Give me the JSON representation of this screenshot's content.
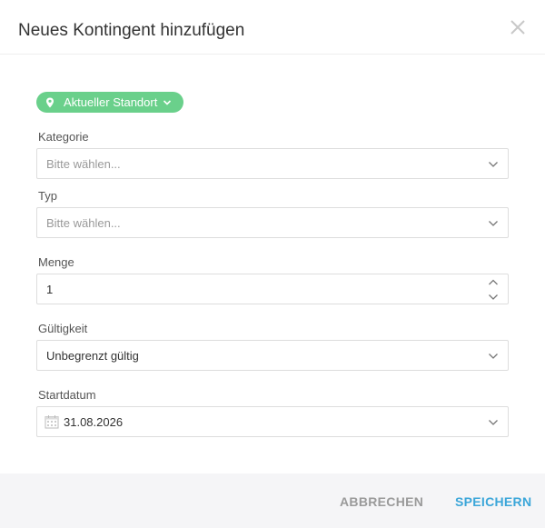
{
  "dialog": {
    "title": "Neues Kontingent hinzufügen",
    "close_icon": "close-icon"
  },
  "location": {
    "label": "Aktueller Standort",
    "icon": "map-pin-icon",
    "color": "#6ad08b"
  },
  "fields": {
    "kategorie": {
      "label": "Kategorie",
      "placeholder": "Bitte wählen..."
    },
    "typ": {
      "label": "Typ",
      "placeholder": "Bitte wählen..."
    },
    "menge": {
      "label": "Menge",
      "value": "1"
    },
    "gueltigkeit": {
      "label": "Gültigkeit",
      "value": "Unbegrenzt gültig"
    },
    "startdatum": {
      "label": "Startdatum",
      "value": "31.08.2026",
      "icon": "calendar-icon"
    }
  },
  "footer": {
    "cancel_label": "ABBRECHEN",
    "save_label": "SPEICHERN",
    "save_color": "#3ba6d9"
  }
}
